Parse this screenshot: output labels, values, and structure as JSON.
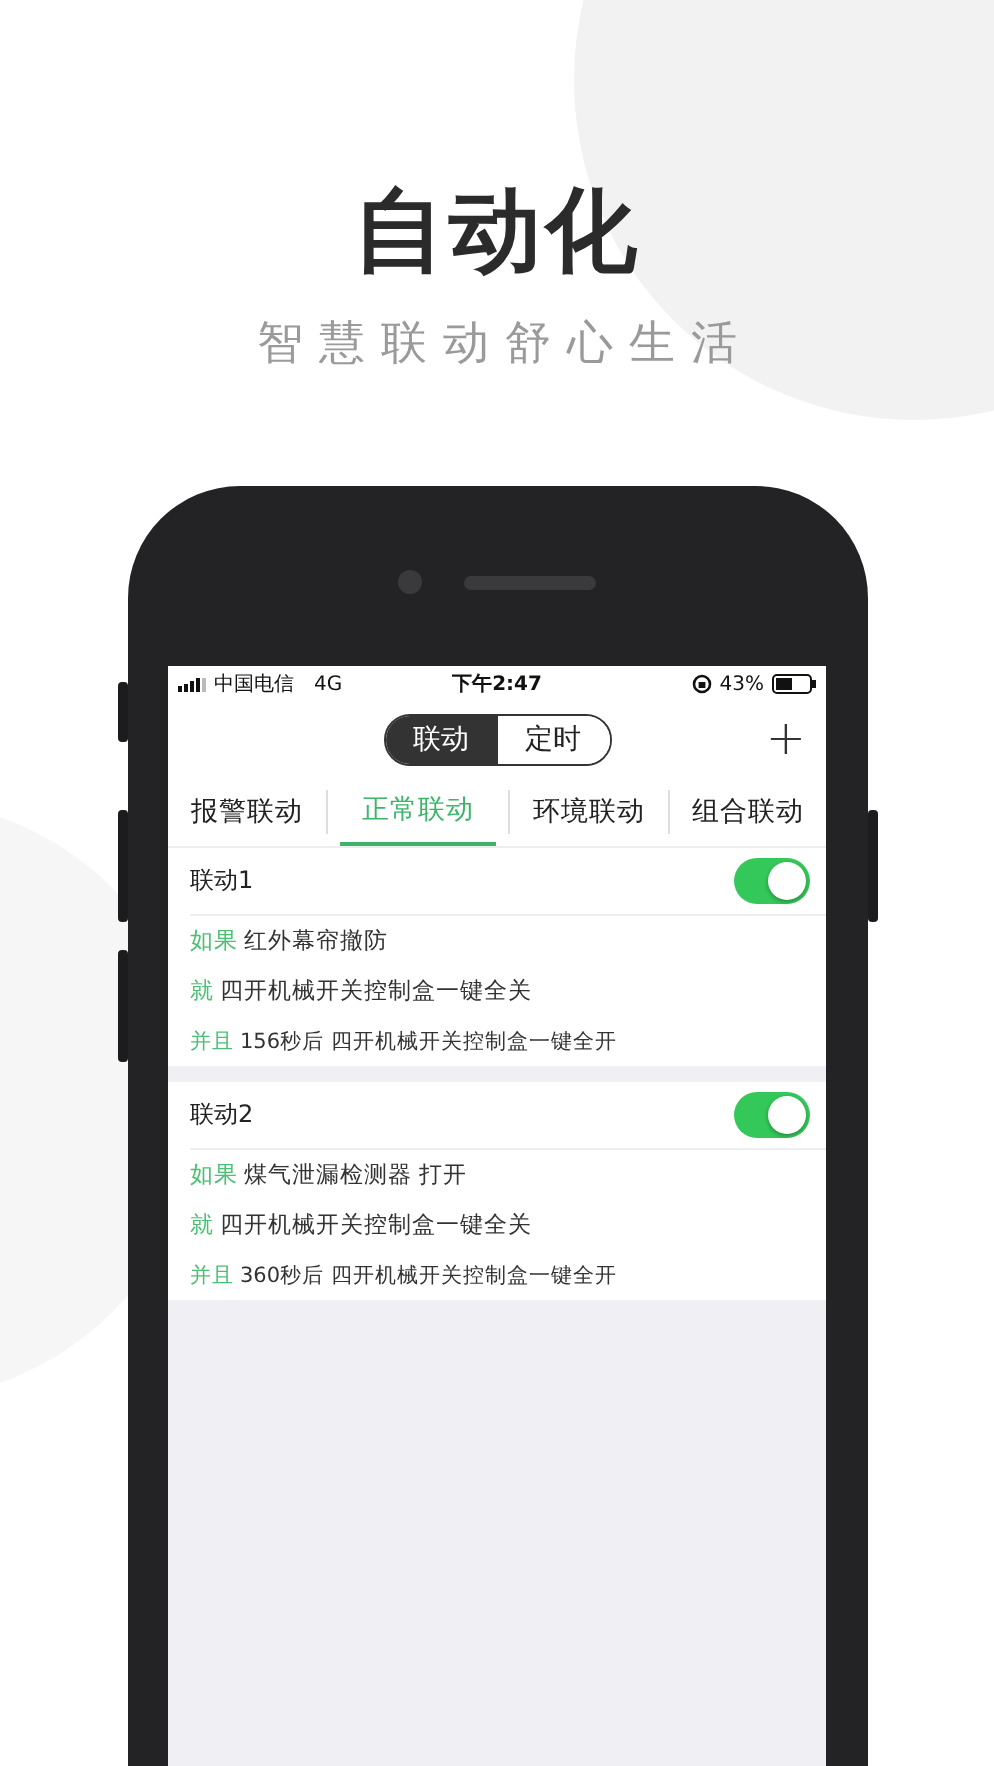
{
  "headline": "自动化",
  "tagline": "智慧联动舒心生活",
  "status_bar": {
    "carrier": "中国电信",
    "network": "4G",
    "time": "下午2:47",
    "battery": "43%"
  },
  "segments": [
    {
      "label": "联动",
      "selected": true
    },
    {
      "label": "定时",
      "selected": false
    }
  ],
  "add_button": "+",
  "tabs": [
    {
      "label": "报警联动",
      "selected": false
    },
    {
      "label": "正常联动",
      "selected": true
    },
    {
      "label": "环境联动",
      "selected": false
    },
    {
      "label": "组合联动",
      "selected": false
    }
  ],
  "linkages": [
    {
      "name": "联动1",
      "on": true,
      "rules": [
        {
          "kind": "main",
          "prefix": "如果",
          "text": "红外幕帘撤防"
        },
        {
          "kind": "main",
          "prefix": "就",
          "text": "四开机械开关控制盒一键全关"
        },
        {
          "kind": "sub",
          "prefix": "并且",
          "text": "156秒后 四开机械开关控制盒一键全开"
        }
      ]
    },
    {
      "name": "联动2",
      "on": true,
      "rules": [
        {
          "kind": "main",
          "prefix": "如果",
          "text": "煤气泄漏检测器 打开"
        },
        {
          "kind": "main",
          "prefix": "就",
          "text": "四开机械开关控制盒一键全关"
        },
        {
          "kind": "sub",
          "prefix": "并且",
          "text": "360秒后 四开机械开关控制盒一键全开"
        }
      ]
    }
  ]
}
